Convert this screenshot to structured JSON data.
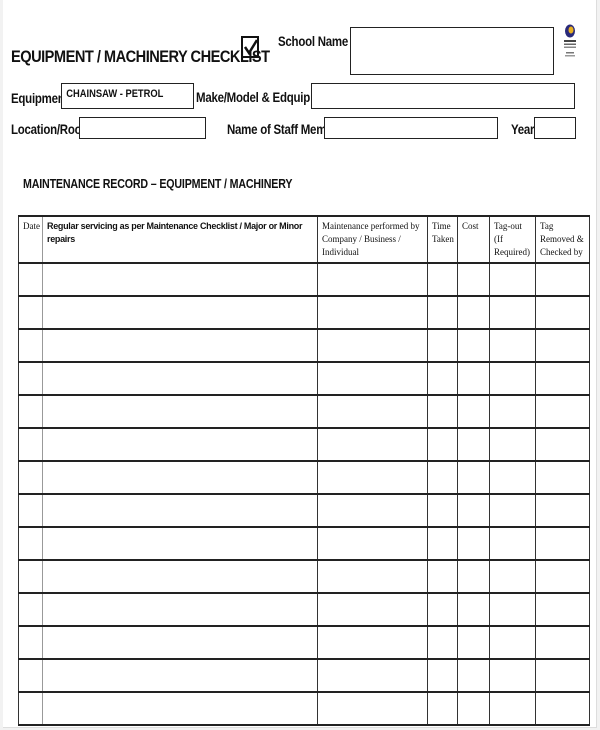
{
  "form": {
    "title": "EQUIPMENT / MACHINERY CHECKLIST",
    "title_checkbox_checked": true,
    "school_name_label": "School Name",
    "school_name_value": "",
    "logo_icon": "department-logo-icon",
    "equipment_label": "Equipment",
    "equipment_value": "CHAINSAW - PETROL",
    "make_model_label": "Make/Model & Edquip No",
    "make_model_value": "",
    "location_label": "Location/Room",
    "location_value": "",
    "staff_label": "Name of Staff Member",
    "staff_value": "",
    "year_label": "Year",
    "year_value": ""
  },
  "section_title": "MAINTENANCE RECORD – EQUIPMENT / MACHINERY",
  "table": {
    "headers": [
      "Date",
      "Regular servicing as per Maintenance Checklist / Major or Minor repairs",
      "Maintenance performed by Company / Business / Individual",
      "Time Taken",
      "Cost",
      "Tag-out (If Required)",
      "Tag Removed & Checked by"
    ],
    "rows": [
      [
        "",
        "",
        "",
        "",
        "",
        "",
        ""
      ],
      [
        "",
        "",
        "",
        "",
        "",
        "",
        ""
      ],
      [
        "",
        "",
        "",
        "",
        "",
        "",
        ""
      ],
      [
        "",
        "",
        "",
        "",
        "",
        "",
        ""
      ],
      [
        "",
        "",
        "",
        "",
        "",
        "",
        ""
      ],
      [
        "",
        "",
        "",
        "",
        "",
        "",
        ""
      ],
      [
        "",
        "",
        "",
        "",
        "",
        "",
        ""
      ],
      [
        "",
        "",
        "",
        "",
        "",
        "",
        ""
      ],
      [
        "",
        "",
        "",
        "",
        "",
        "",
        ""
      ],
      [
        "",
        "",
        "",
        "",
        "",
        "",
        ""
      ],
      [
        "",
        "",
        "",
        "",
        "",
        "",
        ""
      ],
      [
        "",
        "",
        "",
        "",
        "",
        "",
        ""
      ],
      [
        "",
        "",
        "",
        "",
        "",
        "",
        ""
      ],
      [
        "",
        "",
        "",
        "",
        "",
        "",
        ""
      ]
    ]
  }
}
